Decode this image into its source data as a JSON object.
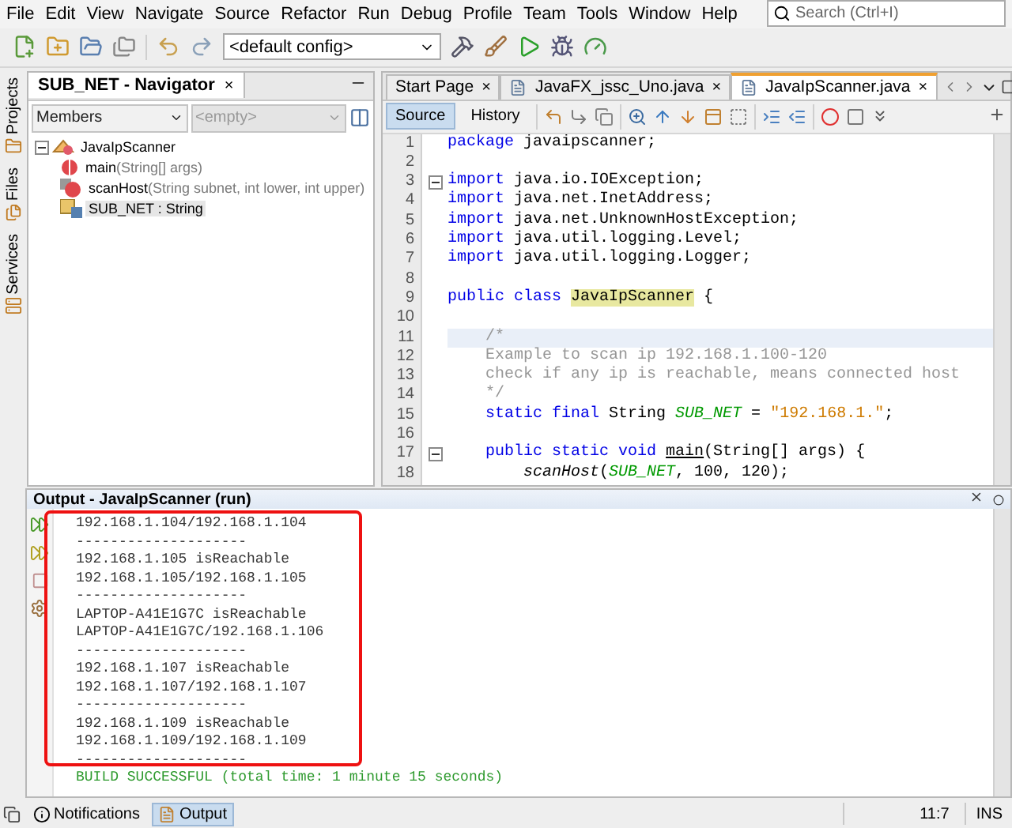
{
  "menu": [
    "File",
    "Edit",
    "View",
    "Navigate",
    "Source",
    "Refactor",
    "Run",
    "Debug",
    "Profile",
    "Team",
    "Tools",
    "Window",
    "Help"
  ],
  "search": {
    "placeholder": "Search (Ctrl+I)"
  },
  "toolbar": {
    "config": "<default config>"
  },
  "side_tabs": [
    "Projects",
    "Files",
    "Services"
  ],
  "navigator": {
    "title": "SUB_NET - Navigator",
    "close": "×",
    "filter": "Members",
    "filter_2": "<empty>",
    "tree": [
      {
        "label": "JavaIpScanner",
        "kind": "class",
        "expanded": true,
        "selected": false,
        "children": [
          {
            "label": "main",
            "detail": "(String[] args)",
            "kind": "method",
            "selected": false
          },
          {
            "label": "scanHost",
            "detail": "(String subnet, int lower, int upper)",
            "kind": "static-method",
            "selected": false
          },
          {
            "label": "SUB_NET : String",
            "kind": "field",
            "selected": true
          }
        ]
      }
    ]
  },
  "editor": {
    "tabs": [
      {
        "label": "Start Page",
        "close": "×",
        "selected": false,
        "file": false
      },
      {
        "label": "JavaFX_jssc_Uno.java",
        "close": "×",
        "selected": false,
        "file": true
      },
      {
        "label": "JavaIpScanner.java",
        "close": "×",
        "selected": true,
        "file": true
      }
    ],
    "view_tabs": [
      {
        "label": "Source",
        "selected": true
      },
      {
        "label": "History",
        "selected": false
      }
    ],
    "lines": [
      {
        "number": "1",
        "current": false,
        "fold": false,
        "tokens": [
          {
            "kind": "keyword",
            "text": "package"
          },
          {
            "kind": "plain",
            "text": " javaipscanner;"
          }
        ]
      },
      {
        "number": "2",
        "current": false,
        "fold": false
      },
      {
        "number": "3",
        "current": false,
        "fold": true,
        "tokens": [
          {
            "kind": "keyword",
            "text": "import"
          },
          {
            "kind": "plain",
            "text": " java.io.IOException;"
          }
        ]
      },
      {
        "number": "4",
        "current": false,
        "fold": false,
        "tokens": [
          {
            "kind": "keyword",
            "text": "import"
          },
          {
            "kind": "plain",
            "text": " java.net.InetAddress;"
          }
        ]
      },
      {
        "number": "5",
        "current": false,
        "fold": false,
        "tokens": [
          {
            "kind": "keyword",
            "text": "import"
          },
          {
            "kind": "plain",
            "text": " java.net.UnknownHostException;"
          }
        ]
      },
      {
        "number": "6",
        "current": false,
        "fold": false,
        "tokens": [
          {
            "kind": "keyword",
            "text": "import"
          },
          {
            "kind": "plain",
            "text": " java.util.logging.Level;"
          }
        ]
      },
      {
        "number": "7",
        "current": false,
        "fold": false,
        "tokens": [
          {
            "kind": "keyword",
            "text": "import"
          },
          {
            "kind": "plain",
            "text": " java.util.logging.Logger;"
          }
        ]
      },
      {
        "number": "8",
        "current": false,
        "fold": false
      },
      {
        "number": "9",
        "current": false,
        "fold": false,
        "tokens": [
          {
            "kind": "keyword",
            "text": "public class "
          },
          {
            "kind": "marked",
            "text": "JavaIpScanner"
          },
          {
            "kind": "plain",
            "text": " {"
          }
        ]
      },
      {
        "number": "10",
        "current": false,
        "fold": false
      },
      {
        "number": "11",
        "current": true,
        "fold": false,
        "tokens": [
          {
            "kind": "comment",
            "text": "    /*"
          }
        ]
      },
      {
        "number": "12",
        "current": false,
        "fold": false,
        "tokens": [
          {
            "kind": "comment",
            "text": "    Example to scan ip 192.168.1.100-120"
          }
        ]
      },
      {
        "number": "13",
        "current": false,
        "fold": false,
        "tokens": [
          {
            "kind": "comment",
            "text": "    check if any ip is reachable, means connected host"
          }
        ]
      },
      {
        "number": "14",
        "current": false,
        "fold": false,
        "tokens": [
          {
            "kind": "comment",
            "text": "    */"
          }
        ]
      },
      {
        "number": "15",
        "current": false,
        "fold": false,
        "tokens": [
          {
            "kind": "keyword",
            "text": "    static final"
          },
          {
            "kind": "plain",
            "text": " String "
          },
          {
            "kind": "field",
            "text": "SUB_NET"
          },
          {
            "kind": "plain",
            "text": " = "
          },
          {
            "kind": "string",
            "text": "\"192.168.1.\""
          },
          {
            "kind": "plain",
            "text": ";"
          }
        ]
      },
      {
        "number": "16",
        "current": false,
        "fold": false
      },
      {
        "number": "17",
        "current": false,
        "fold": true,
        "tokens": [
          {
            "kind": "keyword",
            "text": "    public static void "
          },
          {
            "kind": "method",
            "text": "main"
          },
          {
            "kind": "plain",
            "text": "(String[] args) {"
          }
        ]
      },
      {
        "number": "18",
        "current": false,
        "fold": false,
        "tokens": [
          {
            "kind": "call",
            "text": "        scanHost"
          },
          {
            "kind": "plain",
            "text": "("
          },
          {
            "kind": "field",
            "text": "SUB_NET"
          },
          {
            "kind": "plain",
            "text": ", 100, 120);"
          }
        ]
      }
    ]
  },
  "output": {
    "title": "Output - JavaIpScanner (run)",
    "lines": [
      {
        "kind": "plain",
        "text": "192.168.1.104/192.168.1.104"
      },
      {
        "kind": "plain",
        "text": "--------------------"
      },
      {
        "kind": "plain",
        "text": "192.168.1.105 isReachable"
      },
      {
        "kind": "plain",
        "text": "192.168.1.105/192.168.1.105"
      },
      {
        "kind": "plain",
        "text": "--------------------"
      },
      {
        "kind": "plain",
        "text": "LAPTOP-A41E1G7C isReachable"
      },
      {
        "kind": "plain",
        "text": "LAPTOP-A41E1G7C/192.168.1.106"
      },
      {
        "kind": "plain",
        "text": "--------------------"
      },
      {
        "kind": "plain",
        "text": "192.168.1.107 isReachable"
      },
      {
        "kind": "plain",
        "text": "192.168.1.107/192.168.1.107"
      },
      {
        "kind": "plain",
        "text": "--------------------"
      },
      {
        "kind": "plain",
        "text": "192.168.1.109 isReachable"
      },
      {
        "kind": "plain",
        "text": "192.168.1.109/192.168.1.109"
      },
      {
        "kind": "plain",
        "text": "--------------------"
      },
      {
        "kind": "success",
        "text": "BUILD SUCCESSFUL (total time: 1 minute 15 seconds)"
      }
    ]
  },
  "status_bar": {
    "tabs": [
      {
        "label": "Notifications",
        "selected": false
      },
      {
        "label": "Output",
        "selected": true
      }
    ],
    "position": "11:7",
    "mode": "INS"
  }
}
